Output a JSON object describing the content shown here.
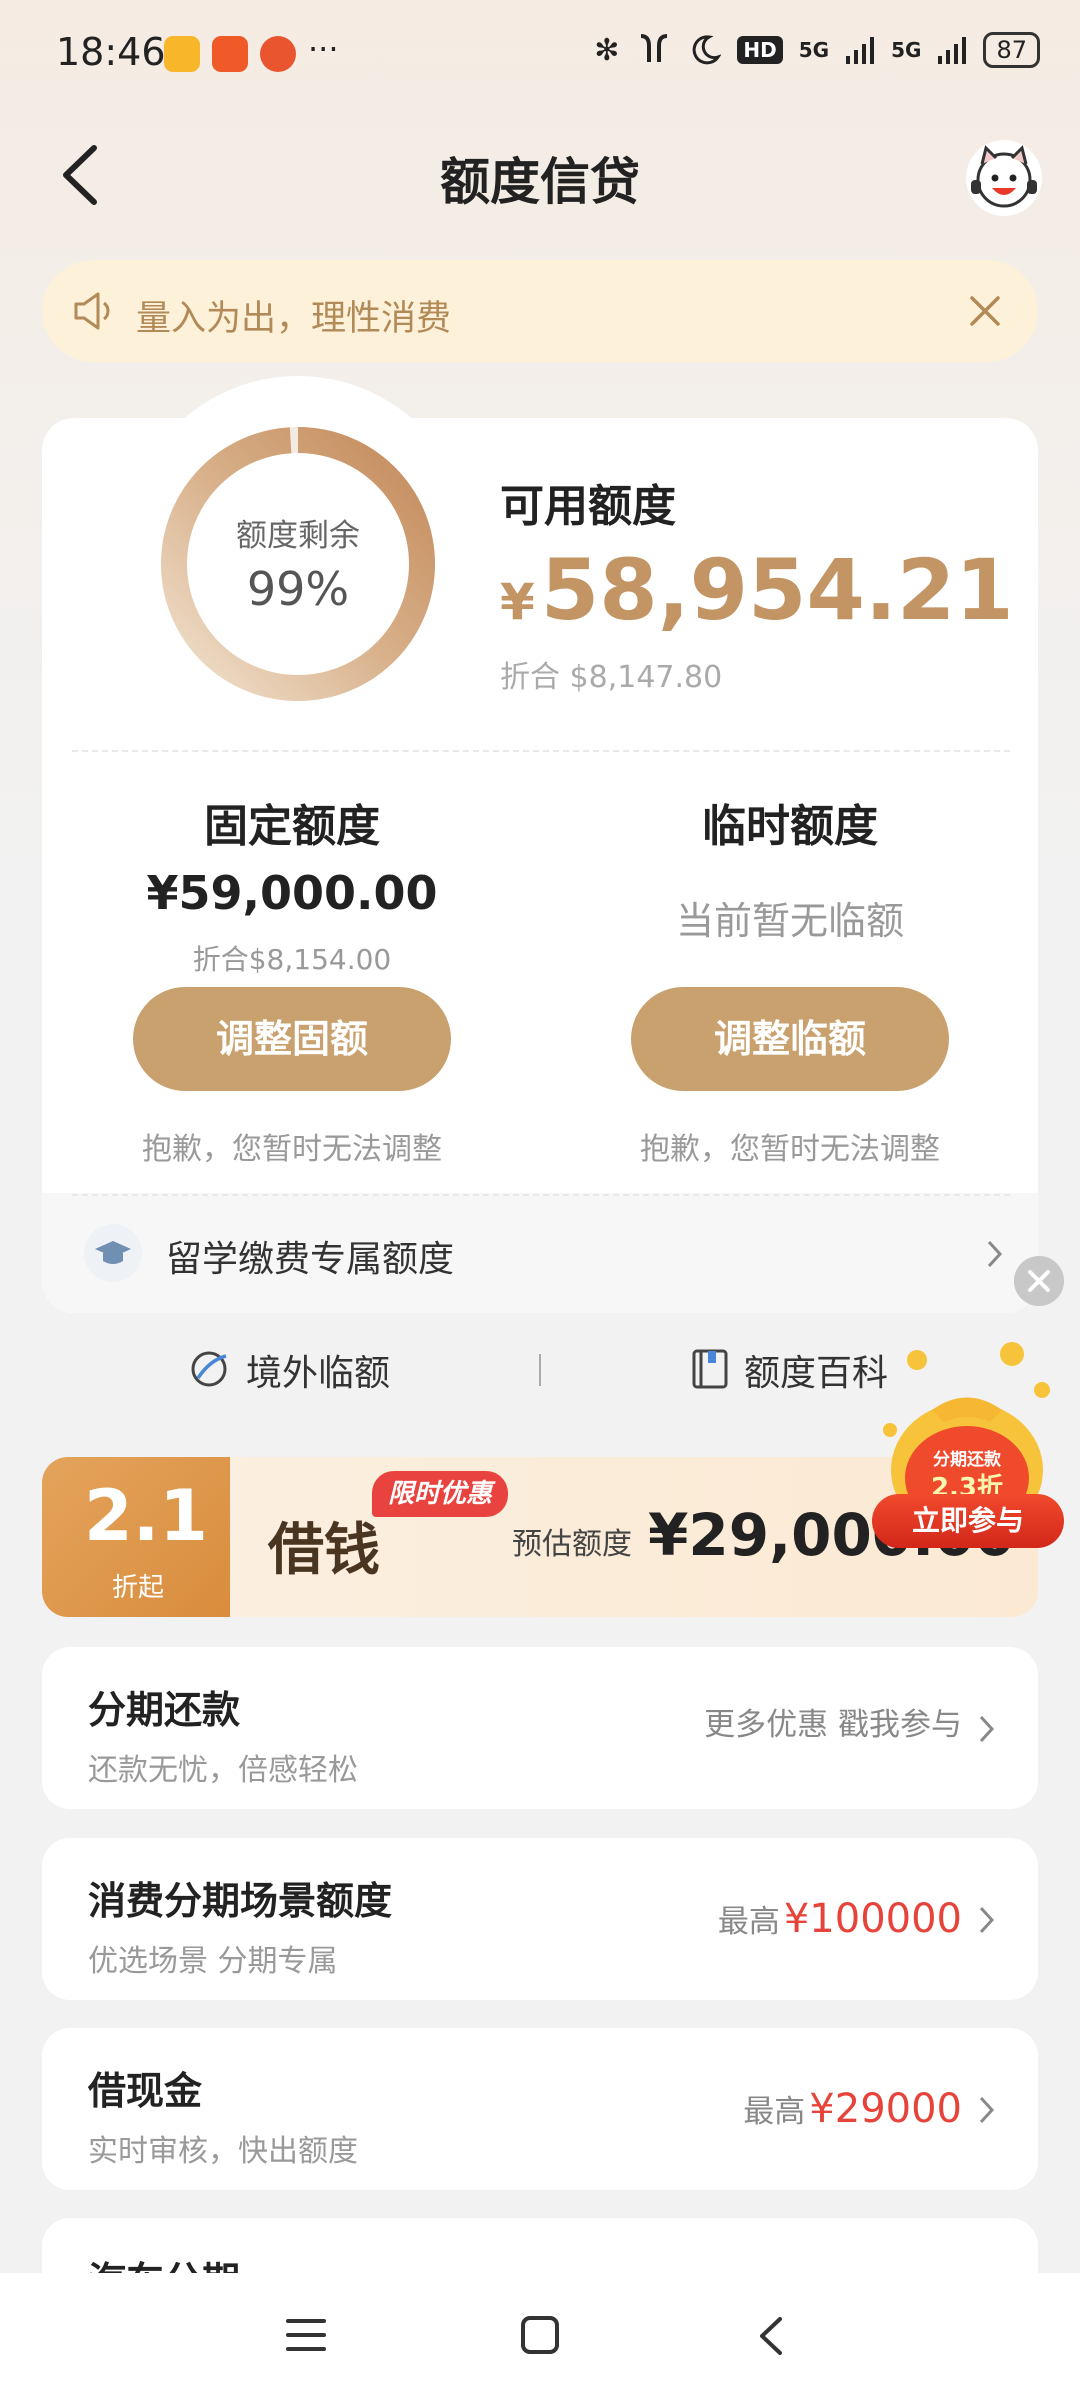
{
  "status_bar": {
    "time": "18:46",
    "bluetooth": "✻",
    "hd": "HD",
    "signal1": "5G",
    "signal2": "5G",
    "battery": "87",
    "more": "···"
  },
  "header": {
    "title": "额度信贷"
  },
  "notice": {
    "text": "量入为出，理性消费"
  },
  "credit": {
    "ring_label": "额度剩余",
    "ring_value": "99%",
    "ring_fraction": 0.99,
    "available_title": "可用额度",
    "available_currency": "¥",
    "available_amount": "58,954.21",
    "available_converted": "折合  $8,147.80",
    "fixed": {
      "title": "固定额度",
      "amount": "¥59,000.00",
      "converted": "折合$8,154.00",
      "button": "调整固额",
      "note": "抱歉，您暂时无法调整"
    },
    "temporary": {
      "title": "临时额度",
      "status": "当前暂无临额",
      "button": "调整临额",
      "note": "抱歉，您暂时无法调整"
    },
    "study_abroad": "留学缴费专属额度",
    "tools": {
      "overseas": "境外临额",
      "encyclopedia": "额度百科"
    }
  },
  "promo": {
    "discount_number": "2.1",
    "discount_suffix": "折起",
    "tag": "限时优惠",
    "main_text": "借钱",
    "estimate_label": "预估额度",
    "estimate_amount": "¥29,000.00",
    "bag_line1": "分期还款",
    "bag_line2": "2.3折",
    "join_button": "立即参与"
  },
  "list": [
    {
      "title": "分期还款",
      "subtitle": "还款无忧，倍感轻松",
      "right_text": "更多优惠 戳我参与",
      "right_prefix": "",
      "right_value": ""
    },
    {
      "title": "消费分期场景额度",
      "subtitle": "优选场景 分期专属",
      "right_text": "",
      "right_prefix": "最高",
      "right_value": "¥100000"
    },
    {
      "title": "借现金",
      "subtitle": "实时审核，快出额度",
      "right_text": "",
      "right_prefix": "最高",
      "right_value": "¥29000"
    },
    {
      "title": "汽车分期",
      "subtitle": "",
      "right_text": "",
      "right_prefix": "",
      "right_value": ""
    }
  ],
  "colors": {
    "accent_gold": "#c9a16e",
    "amount_gold": "#c39564",
    "price_red": "#e6443b",
    "notice_bg": "#fdf1da"
  }
}
